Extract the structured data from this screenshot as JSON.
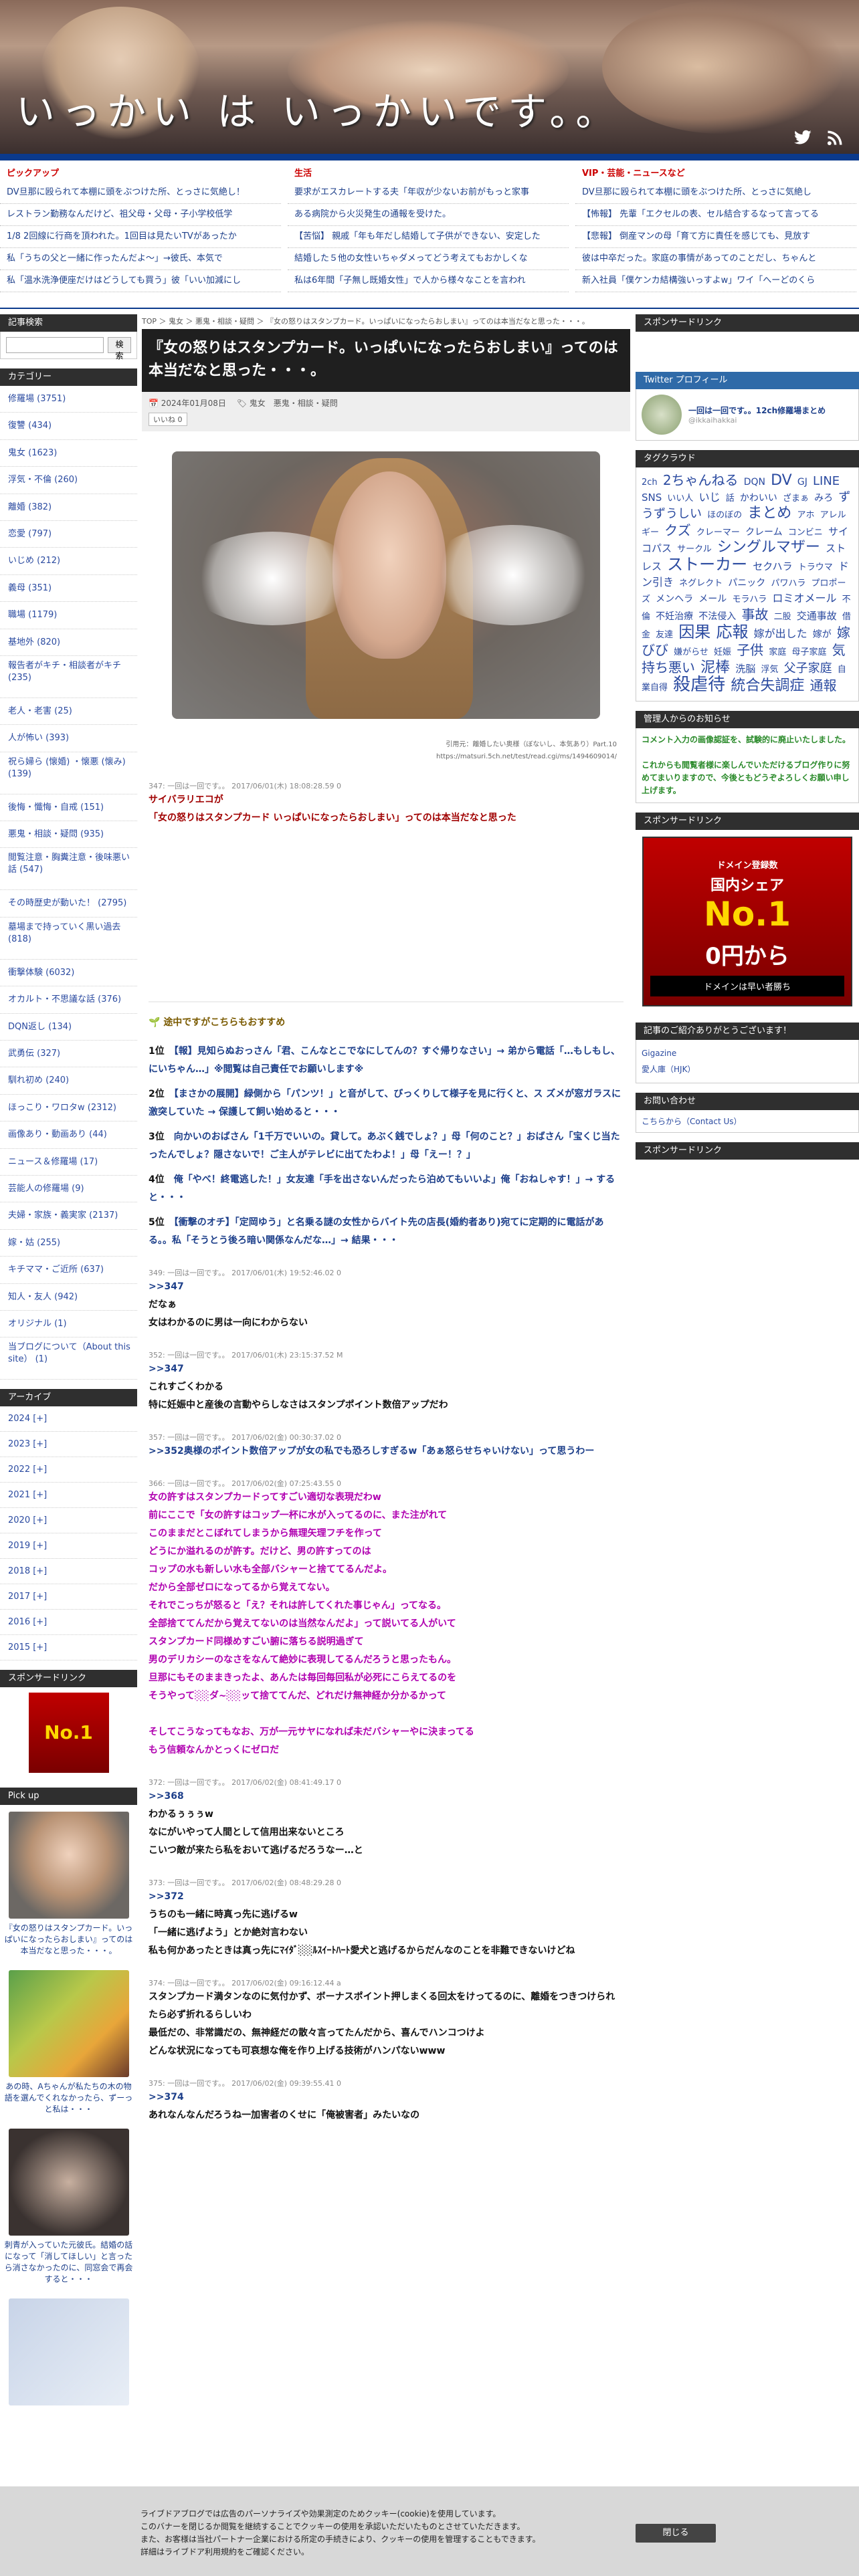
{
  "site": {
    "title": "いっかい は いっかいです。。",
    "twitter_icon": "twitter-bird-icon",
    "rss_icon": "rss-icon"
  },
  "ticker": {
    "heads": [
      "ピックアップ",
      "生活",
      "VIP・芸能・ニュースなど"
    ],
    "rows": [
      [
        "DV旦那に殴られて本棚に頭をぶつけた所、とっさに気絶し！",
        "要求がエスカレートする夫「年収が少ないお前がもっと家事",
        "DV旦那に殴られて本棚に頭をぶつけた所、とっさに気絶し"
      ],
      [
        "レストラン勤務なんだけど、祖父母・父母・子小学校低学",
        "ある病院から火災発生の通報を受けた。",
        "【怖報】 先輩「エクセルの表、セル結合するなって言ってる"
      ],
      [
        "1/8 2回線に行商を頂われた。1回目は見たいTVがあったか",
        "【苦悩】 親戚「年も年だし結婚して子供ができない、安定した",
        "【悲報】 倒産マンの母「育て方に責任を感じても、見放す"
      ],
      [
        "私「うちの父と一緒に作ったんだよ〜」→彼氏、本気で",
        "結婚した５他の女性いちゃダメってどう考えてもおかしくな",
        "彼は中卒だった。家庭の事情があってのことだし、ちゃんと"
      ],
      [
        "私「温水洗浄便座だけはどうしても買う」彼「いい加減にし",
        "私は6年間「子無し既婚女性」で人から様々なことを言われ",
        "新入社員「僕ケンカ結構強いっすよw」ワイ「へーどのくら"
      ]
    ]
  },
  "left_sidebar": {
    "search_head": "記事検索",
    "search_button": "検索",
    "category_head": "カテゴリー",
    "categories": [
      "修羅場 (3751)",
      "復讐 (434)",
      "鬼女 (1623)",
      "浮気・不倫 (260)",
      "離婚 (382)",
      "恋愛 (797)",
      "いじめ (212)",
      "義母 (351)",
      "職場 (1179)",
      "基地外 (820)",
      "報告者がキチ・相談者がキチ (235)",
      "老人・老害 (25)",
      "人が怖い (393)",
      "祝ら婦ら (懐婚) ・懐悪 (懐み) (139)",
      "後悔・懺悔・自戒 (151)",
      "悪鬼・相談・疑問 (935)",
      "閲覧注意・胸糞注意・後味悪い話 (547)",
      "その時歴史が動いた！ (2795)",
      "墓場まで持っていく黒い過去 (818)",
      "衝撃体験 (6032)",
      "オカルト・不思議な話 (376)",
      "DQN返し (134)",
      "武勇伝 (327)",
      "馴れ初め (240)",
      "ほっこり・ワロタw (2312)",
      "画像あり・動画あり (44)",
      "ニュース＆修羅場 (17)",
      "芸能人の修羅場 (9)",
      "夫婦・家族・義実家 (2137)",
      "嫁・姑 (255)",
      "キチママ・ご近所 (637)",
      "知人・友人 (942)",
      "オリジナル (1)",
      "当ブログについて（About this site） (1)"
    ],
    "archive_head": "アーカイブ",
    "archives": [
      "2024 [+]",
      "2023 [+]",
      "2022 [+]",
      "2021 [+]",
      "2020 [+]",
      "2019 [+]",
      "2018 [+]",
      "2017 [+]",
      "2016 [+]",
      "2015 [+]"
    ],
    "sponsor_head": "スポンサードリンク",
    "pickup_head": "Pick up",
    "pickups": [
      "『女の怒りはスタンプカード。いっぱいになったらおしまい』ってのは本当だなと思った・・・。",
      "あの時、Aちゃんが私たちの木の物語を選んでくれなかったら、ずーっと私は・・・",
      "刺青が入っていた元彼氏。結婚の話になって「消してほしい」と言ったら消さなかったのに、同窓会で再会すると・・・"
    ]
  },
  "breadcrumb": "TOP ＞ 鬼女 ＞ 悪鬼・相談・疑問 ＞ 『女の怒りはスタンプカード。いっぱいになったらおしまい』ってのは本当だなと思った・・・。",
  "article": {
    "title": "『女の怒りはスタンプカード。いっぱいになったらおしまい』ってのは本当だなと思った・・・。",
    "date": "2024年01月08日",
    "tags": "鬼女　悪鬼・相談・疑問",
    "like": "いいね 0",
    "image_credit": "引用元：離婚したい奥様（ぼないし、本気あり）Part.10",
    "image_url": "https://matsuri.5ch.net/test/read.cgi/ms/1494609014/",
    "posts": [
      {
        "head": "347: 一回は一回です。。 2017/06/01(木) 18:08:28.59 0",
        "lines": [
          "サイバラリエコが",
          "「女の怒りはスタンプカード いっぱいになったらおしまい」ってのは本当だなと思った"
        ],
        "style": "red"
      },
      {
        "head": "349: 一回は一回です。。 2017/06/01(木) 19:52:46.02 0",
        "lines": [
          ">>347",
          "だなぁ",
          "女はわかるのに男は一向にわからない"
        ],
        "style": ""
      },
      {
        "head": "352: 一回は一回です。。 2017/06/01(木) 23:15:37.52 M",
        "lines": [
          ">>347",
          "これすごくわかる",
          "特に妊娠中と産後の言動やらしなさはスタンプポイント数倍アップだわ"
        ],
        "style": ""
      },
      {
        "head": "357: 一回は一回です。。 2017/06/02(金) 00:30:37.02 0",
        "lines": [
          ">>352奥様のポイント数倍アップが女の私でも恐ろしすぎるw「あぁ怒らせちゃいけない」って思うわー"
        ],
        "style": ""
      },
      {
        "head": "366: 一回は一回です。。 2017/06/02(金) 07:25:43.55 0",
        "lines": [
          "女の許すはスタンプカードってすごい適切な表現だわw",
          "前にここで「女の許すはコップ一杯に水が入ってるのに、また注がれて",
          "このままだとこぼれてしまうから無理矢理フチを作って",
          "どうにか溢れるのが許す。だけど、男の許すってのは",
          "コップの水も新しい水も全部バシャーと捨ててるんだよ。",
          "だから全部ゼロになってるから覚えてない。",
          "それでこっちが怒ると「え？それは許してくれた事じゃん」ってなる。",
          "全部捨ててんだから覚えてないのは当然なんだよ」って説いてる人がいて",
          "スタンプカード同様めすごい腑に落ちる説明過ぎて",
          "男のデリカシーのなさをなんて絶妙に表現してるんだろうと思ったもん。",
          "旦那にもそのままきったよ、あんたは毎回毎回私が必死にこらえてるのを",
          "そうやって░░ダ~░░ッて捨ててんだ、どれだけ無神経か分かるかって",
          "",
          "そしてこうなってもなお、万が一元サヤになれば未だバシャーやに決まってる",
          "もう信頼なんかとっくにゼロだ"
        ],
        "style": "pink"
      },
      {
        "head": "372: 一回は一回です。。 2017/06/02(金) 08:41:49.17 0",
        "lines": [
          ">>368",
          "わかるぅぅぅw",
          "なにがいやって人間として信用出来ないところ",
          "こいつ敵が来たら私をおいて逃げるだろうなー…と"
        ],
        "style": ""
      },
      {
        "head": "373: 一回は一回です。。 2017/06/02(金) 08:48:29.28 0",
        "lines": [
          ">>372",
          "うちのも一緒に時真っ先に逃げるw",
          "「一緒に逃げよう」とか絶対言わない",
          "私も何かあったときは真っ先にﾏｲﾀﾞ░░ﾙｽｲｰﾄﾊｰﾄ愛犬と逃げるからだんなのことを非難できないけどね"
        ],
        "style": ""
      },
      {
        "head": "374: 一回は一回です。。 2017/06/02(金) 09:16:12.44 a",
        "lines": [
          "スタンプカード満タンなのに気付かず、ボーナスポイント押しまくる回太をけってるのに、離婚をつきつけられたら必ず折れるらしいわ",
          "最低だの、非常識だの、無神経だの散々言ってたんだから、喜んでハンコつけよ",
          "どんな状況になっても可哀想な俺を作り上げる技術がハンパないwww"
        ],
        "style": ""
      },
      {
        "head": "375: 一回は一回です。。 2017/06/02(金) 09:39:55.41 0",
        "lines": [
          ">>374",
          "あれなんなんだろうね一加害者のくせに「俺被害者」みたいなの"
        ],
        "style": ""
      }
    ],
    "rank_head": "途中ですがこちらもおすすめ",
    "rank": [
      {
        "no": "1位",
        "text": "【報】見知らぬおっさん「君、こんなとこでなにしてんの？すぐ帰りなさい」→ 弟から電話「…もしもし、にいちゃん…」※閲覧は自己責任でお願いします※"
      },
      {
        "no": "2位",
        "text": "【まさかの展開】緑側から「パンツ！」と音がして、びっくりして様子を見に行くと、ス ズメが窓ガラスに激突していた → 保護して飼い始めると・・・"
      },
      {
        "no": "3位",
        "text": "向かいのおばさん「1千万でいいの。貸して。あぶく銭でしょ？」母「何のこと？」おばさん「宝くじ当たったんでしょ？隠さないで！ご主人がテレビに出てたわよ！」母「えー！？」"
      },
      {
        "no": "4位",
        "text": "俺「やべ！終電逃した！」女友達「手を出さないんだったら泊めてもいいよ」俺「おねしゃす！」→ すると・・・"
      },
      {
        "no": "5位",
        "text": "【衝撃のオチ】「定岡ゆう」と名乗る謎の女性からバイト先の店長(婚約者あり)宛てに定期的に電話がある。。私「そうとう後ろ暗い関係なんだな…」→ 結果・・・"
      }
    ]
  },
  "right_sidebar": {
    "sponsor_head": "スポンサードリンク",
    "twitter_head": "Twitter プロフィール",
    "twitter_name": "一回は一回です。。12ch修羅場まとめ",
    "twitter_handle": "@ikkaihakkai",
    "tag_head": "タグクラウド",
    "tags": [
      "2ch",
      "2ちゃんねる",
      "DQN",
      "DV",
      "GJ",
      "LINE",
      "SNS",
      "いい人",
      "いじ",
      "話",
      "かわいい",
      "ざまぁ",
      "みろ",
      "ずうずうしい",
      "ほのぼの",
      "まとめ",
      "アホ",
      "アレルギー",
      "クズ",
      "クレーマー",
      "クレーム",
      "コンビニ",
      "サイコパス",
      "サークル",
      "シングルマザー",
      "ストレス",
      "ストーカー",
      "セクハラ",
      "トラウマ",
      "ドン引き",
      "ネグレクト",
      "パニック",
      "パワハラ",
      "プロポーズ",
      "メンヘラ",
      "メール",
      "モラハラ",
      "ロミオメール",
      "不倫",
      "不妊治療",
      "不法侵入",
      "事故",
      "二股",
      "交通事故",
      "借金",
      "友達",
      "因果",
      "応報",
      "嫁が出した",
      "嫁が",
      "嫁びび",
      "嫌がらせ",
      "妊娠",
      "子供",
      "家庭",
      "母子家庭",
      "気持ち悪い",
      "泥棒",
      "洗脳",
      "浮気",
      "父子家庭",
      "自業自得",
      "殺虐待",
      "統合失調症",
      "通報"
    ],
    "notice_head": "管理人からのお知らせ",
    "notice": "コメント入力の画像認証を、試験的に廃止いたしました。\n\nこれからも閲覧者様に楽しんでいただけるブログ作りに努めてまいりますので、今後ともどうぞよろしくお願い申し上げます。",
    "ad_no1": "No.1",
    "ad_line1": "ドメイン登録数",
    "ad_line2": "国内シェア",
    "ad_line3": "0円から",
    "ad_line4": "ドメインは早い者勝ち",
    "intro_head": "記事のご紹介ありがとうございます！",
    "intro_links": [
      "Gigazine",
      "愛人庫（HJK）"
    ],
    "contact_head": "お問い合わせ",
    "contact_link": "こちらから（Contact Us）",
    "sponsor2_head": "スポンサードリンク"
  },
  "cookie": {
    "line1": "ライブドアブログでは広告のパーソナライズや効果測定のためクッキー(cookie)を使用しています。",
    "line2": "このバナーを閉じるか閲覧を継続することでクッキーの使用を承認いただいたものとさせていただきます。",
    "line3": "また、お客様は当社パートナー企業における所定の手続きにより、クッキーの使用を管理することもできます。",
    "line4": "詳細はライブドア利用規約をご確認ください。",
    "close": "閉じる"
  }
}
